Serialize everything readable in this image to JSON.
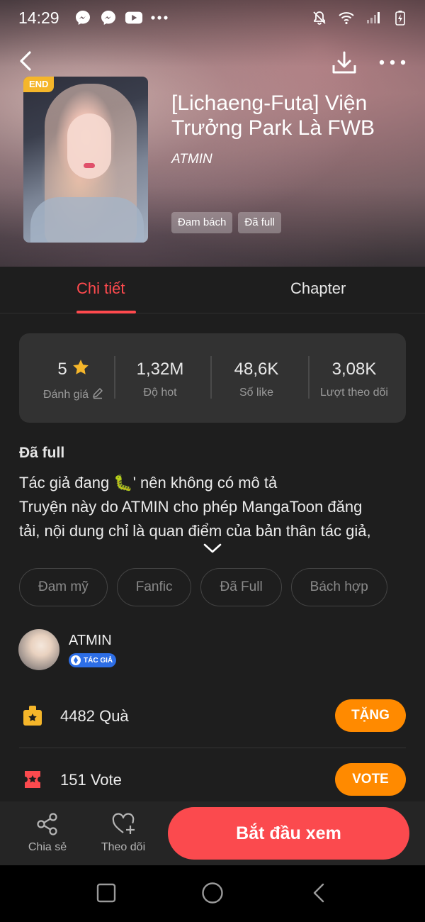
{
  "status_bar": {
    "time": "14:29",
    "left_icons": [
      "messenger-icon",
      "messenger-icon",
      "youtube-icon",
      "more-dots-icon"
    ],
    "right_icons": [
      "mute-icon",
      "wifi-icon",
      "signal-icon",
      "battery-charging-icon"
    ]
  },
  "header": {
    "badge": "END",
    "title": "[Lichaeng-Futa] Viện Trưởng Park Là FWB",
    "author": "ATMIN",
    "genres": [
      "Đam bách",
      "Đã full"
    ]
  },
  "tabs": [
    {
      "label": "Chi tiết",
      "active": true
    },
    {
      "label": "Chapter",
      "active": false
    }
  ],
  "stats": [
    {
      "value": "5",
      "label": "Đánh giá"
    },
    {
      "value": "1,32M",
      "label": "Độ hot"
    },
    {
      "value": "48,6K",
      "label": "Số like"
    },
    {
      "value": "3,08K",
      "label": "Lượt theo dõi"
    }
  ],
  "description": {
    "status": "Đã full",
    "line1": "Tác giả đang 🐛' nên không có mô tả",
    "line2": "Truyện này do ATMIN cho phép MangaToon đăng",
    "line3": "tải, nội dung chỉ là quan điểm của bản thân tác giả,"
  },
  "tags": [
    "Đam mỹ",
    "Fanfic",
    "Đã Full",
    "Bách hợp"
  ],
  "author_section": {
    "name": "ATMIN",
    "badge": "TÁC GIẢ"
  },
  "gift_row": {
    "count": "4482",
    "label": "Quà",
    "button": "TẶNG"
  },
  "vote_row": {
    "count": "151",
    "label": "Vote",
    "button": "VOTE"
  },
  "bottom_bar": {
    "share_label": "Chia sẻ",
    "follow_label": "Theo dõi",
    "start_label": "Bắt đầu xem"
  },
  "colors": {
    "accent": "#ff4a4e",
    "orange": "#ff8a00",
    "end_badge": "#f5b62a",
    "star": "#f5b62a",
    "author_badge": "#2d6ee6"
  }
}
